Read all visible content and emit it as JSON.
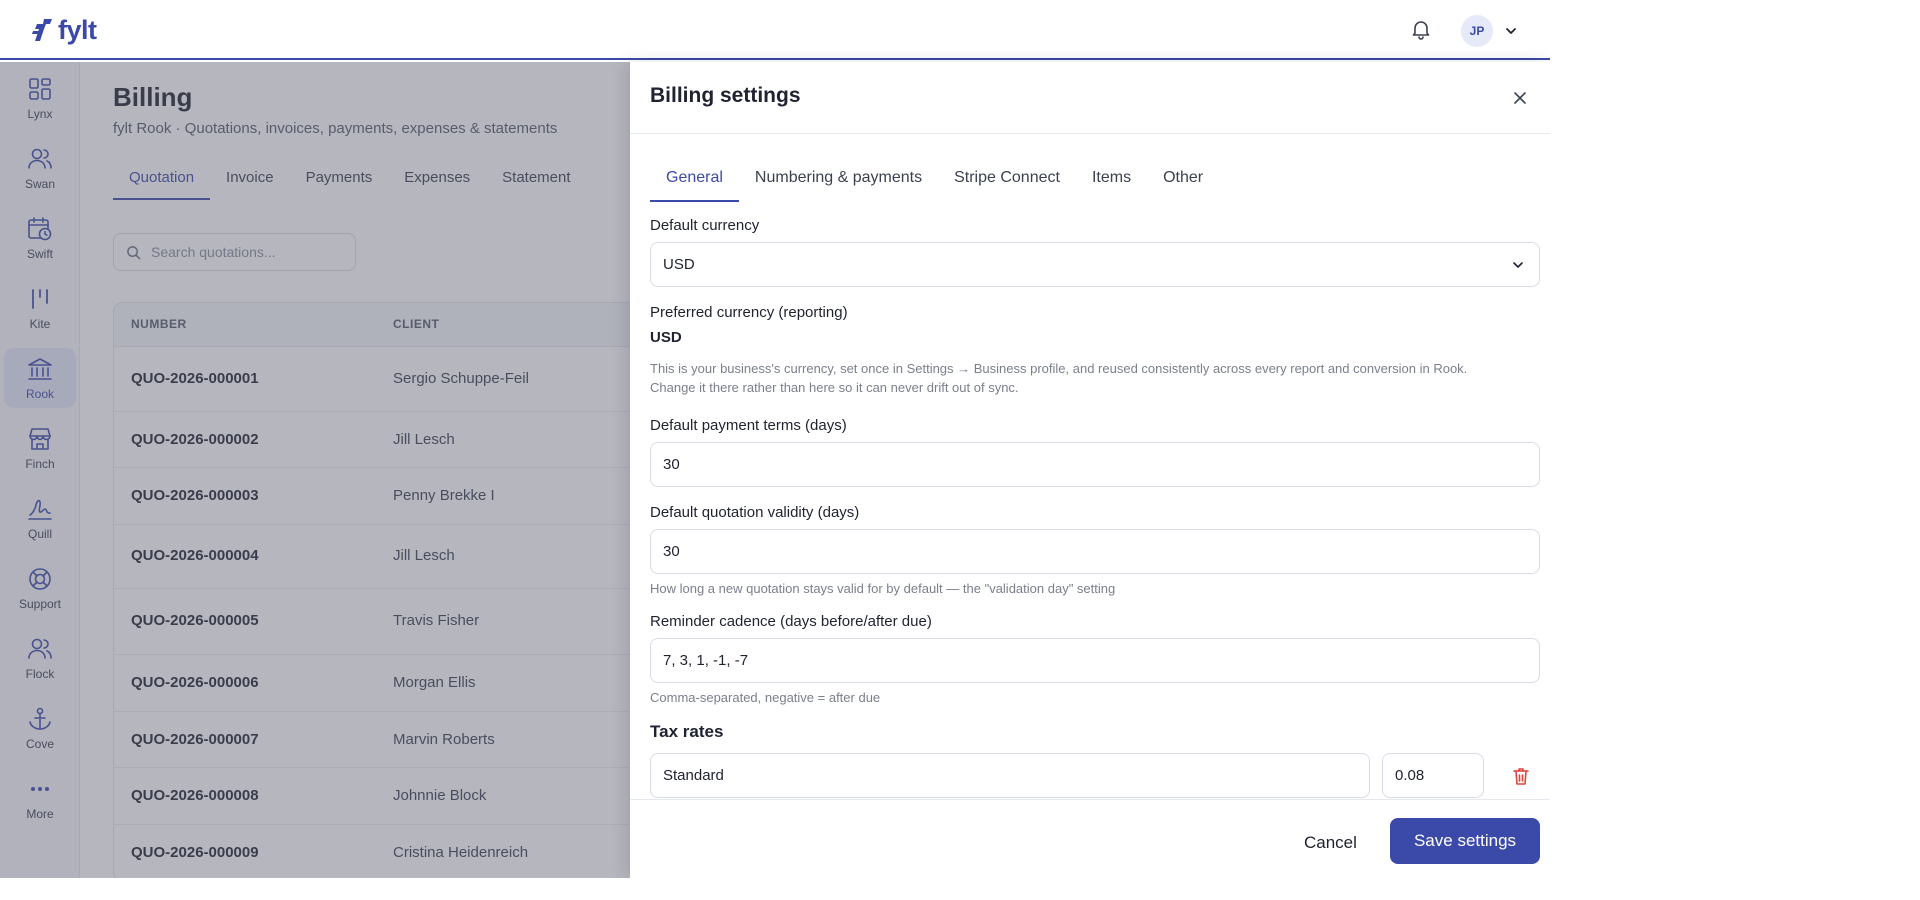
{
  "brand": {
    "name": "fylt"
  },
  "user": {
    "initials": "JP"
  },
  "sidebar": {
    "items": [
      {
        "label": "Lynx"
      },
      {
        "label": "Swan"
      },
      {
        "label": "Swift"
      },
      {
        "label": "Kite"
      },
      {
        "label": "Rook"
      },
      {
        "label": "Finch"
      },
      {
        "label": "Quill"
      },
      {
        "label": "Support"
      },
      {
        "label": "Flock"
      },
      {
        "label": "Cove"
      },
      {
        "label": "More"
      }
    ]
  },
  "billing": {
    "title": "Billing",
    "subtitle": "fylt Rook · Quotations, invoices, payments, expenses & statements",
    "tabs": [
      {
        "label": "Quotation"
      },
      {
        "label": "Invoice"
      },
      {
        "label": "Payments"
      },
      {
        "label": "Expenses"
      },
      {
        "label": "Statement"
      }
    ],
    "search_placeholder": "Search quotations...",
    "columns": [
      "NUMBER",
      "CLIENT"
    ],
    "rows": [
      {
        "number": "QUO-2026-000001",
        "client": "Sergio Schuppe-Feil"
      },
      {
        "number": "QUO-2026-000002",
        "client": "Jill Lesch"
      },
      {
        "number": "QUO-2026-000003",
        "client": "Penny Brekke I"
      },
      {
        "number": "QUO-2026-000004",
        "client": "Jill Lesch"
      },
      {
        "number": "QUO-2026-000005",
        "client": "Travis Fisher"
      },
      {
        "number": "QUO-2026-000006",
        "client": "Morgan Ellis"
      },
      {
        "number": "QUO-2026-000007",
        "client": "Marvin Roberts"
      },
      {
        "number": "QUO-2026-000008",
        "client": "Johnnie Block"
      },
      {
        "number": "QUO-2026-000009",
        "client": "Cristina Heidenreich"
      }
    ]
  },
  "drawer": {
    "title": "Billing settings",
    "tabs": [
      {
        "label": "General"
      },
      {
        "label": "Numbering & payments"
      },
      {
        "label": "Stripe Connect"
      },
      {
        "label": "Items"
      },
      {
        "label": "Other"
      }
    ],
    "default_currency": {
      "label": "Default currency",
      "value": "USD"
    },
    "preferred_currency": {
      "label": "Preferred currency (reporting)",
      "value": "USD",
      "help_1": "This is your business's currency, set once in Settings → Business profile, and reused consistently across every report and conversion in Rook.",
      "help_2": "Change it there rather than here so it can never drift out of sync."
    },
    "payment_terms": {
      "label": "Default payment terms (days)",
      "value": "30"
    },
    "quotation_validity": {
      "label": "Default quotation validity (days)",
      "value": "30",
      "help": "How long a new quotation stays valid for by default — the \"validation day\" setting"
    },
    "reminder_cadence": {
      "label": "Reminder cadence (days before/after due)",
      "value": "7, 3, 1, -1, -7",
      "help": "Comma-separated, negative = after due"
    },
    "tax_rates": {
      "title": "Tax rates",
      "rows": [
        {
          "name": "Standard",
          "rate": "0.08"
        }
      ]
    },
    "cancel_label": "Cancel",
    "save_label": "Save settings"
  },
  "colors": {
    "accent": "#3b4aa8",
    "danger": "#d9453b"
  }
}
